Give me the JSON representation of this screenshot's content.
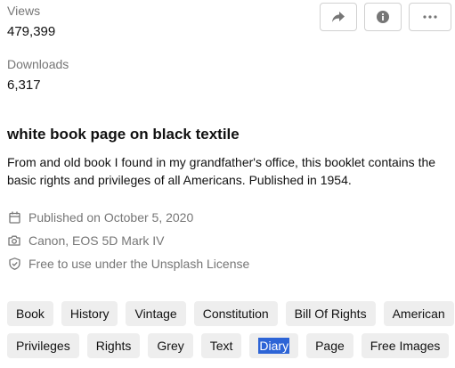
{
  "stats": {
    "views_label": "Views",
    "views_value": "479,399",
    "downloads_label": "Downloads",
    "downloads_value": "6,317"
  },
  "actions": {
    "share_icon": "share-arrow-icon",
    "info_icon": "info-icon",
    "more_icon": "ellipsis-icon"
  },
  "photo": {
    "title": "white book page on black textile",
    "description": "From and old book I found in my grandfather's office, this booklet contains the basic rights and privileges of all Americans. Published in 1954."
  },
  "meta": {
    "published": "Published on October 5, 2020",
    "camera": "Canon, EOS 5D Mark IV",
    "license": "Free to use under the Unsplash License"
  },
  "tags": {
    "row1": [
      "Book",
      "History",
      "Vintage",
      "Constitution",
      "Bill Of Rights",
      "American"
    ],
    "row2": [
      "Privileges",
      "Rights",
      "Grey",
      "Text",
      "Diary",
      "Page",
      "Free Images"
    ]
  },
  "colors": {
    "muted_text": "#767676",
    "tag_bg": "#eeeeee",
    "selection_bg": "#2d64d6"
  }
}
